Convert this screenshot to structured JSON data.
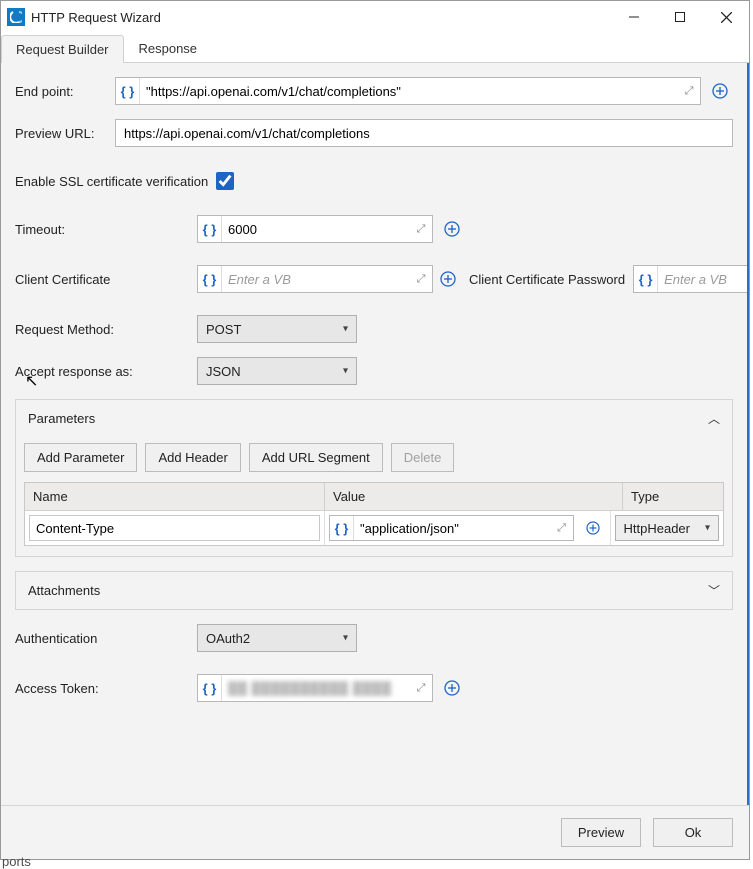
{
  "window": {
    "title": "HTTP Request Wizard"
  },
  "tabs": {
    "builder": "Request Builder",
    "response": "Response"
  },
  "labels": {
    "endpoint": "End point:",
    "preview_url": "Preview URL:",
    "ssl": "Enable SSL certificate verification",
    "timeout": "Timeout:",
    "client_cert": "Client Certificate",
    "client_cert_pwd": "Client Certificate Password",
    "method": "Request Method:",
    "accept": "Accept response as:",
    "auth": "Authentication",
    "access_token": "Access Token:"
  },
  "endpoint": {
    "value": "\"https://api.openai.com/v1/chat/completions\""
  },
  "preview_url": {
    "value": "https://api.openai.com/v1/chat/completions"
  },
  "ssl_checked": true,
  "timeout": {
    "value": "6000"
  },
  "client_cert": {
    "placeholder": "Enter a VB"
  },
  "client_cert_pwd": {
    "placeholder": "Enter a VB"
  },
  "method": {
    "value": "POST"
  },
  "accept": {
    "value": "JSON"
  },
  "parameters": {
    "title": "Parameters",
    "buttons": {
      "add_param": "Add Parameter",
      "add_header": "Add Header",
      "add_url_seg": "Add URL Segment",
      "delete": "Delete"
    },
    "columns": {
      "name": "Name",
      "value": "Value",
      "type": "Type"
    },
    "rows": [
      {
        "name": "Content-Type",
        "value": "\"application/json\"",
        "type": "HttpHeader"
      }
    ]
  },
  "attachments": {
    "title": "Attachments"
  },
  "auth": {
    "value": "OAuth2"
  },
  "access_token": {
    "value": "██ ██████████ ████"
  },
  "footer": {
    "preview": "Preview",
    "ok": "Ok"
  },
  "stray": {
    "ports": "ports"
  }
}
